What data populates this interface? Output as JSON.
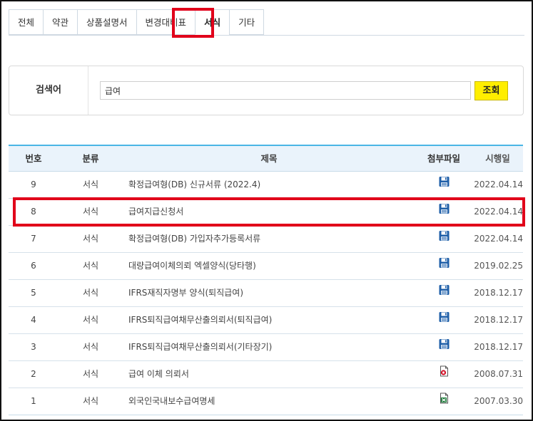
{
  "tabs": [
    {
      "label": "전체",
      "active": false
    },
    {
      "label": "약관",
      "active": false
    },
    {
      "label": "상품설명서",
      "active": false
    },
    {
      "label": "변경대비표",
      "active": false
    },
    {
      "label": "서식",
      "active": true
    },
    {
      "label": "기타",
      "active": false
    }
  ],
  "search": {
    "label": "검색어",
    "value": "급여",
    "button": "조회"
  },
  "table": {
    "headers": {
      "no": "번호",
      "category": "분류",
      "title": "제목",
      "attachment": "첨부파일",
      "date": "시행일"
    },
    "rows": [
      {
        "no": "9",
        "category": "서식",
        "title": "확정급여형(DB) 신규서류 (2022.4)",
        "icon": "save-icon",
        "date": "2022.04.14"
      },
      {
        "no": "8",
        "category": "서식",
        "title": "급여지급신청서",
        "icon": "save-icon",
        "date": "2022.04.14"
      },
      {
        "no": "7",
        "category": "서식",
        "title": "확정급여형(DB) 가입자추가등록서류",
        "icon": "save-icon",
        "date": "2022.04.14"
      },
      {
        "no": "6",
        "category": "서식",
        "title": "대량급여이체의뢰 엑셀양식(당타행)",
        "icon": "save-icon",
        "date": "2019.02.25"
      },
      {
        "no": "5",
        "category": "서식",
        "title": "IFRS재직자명부 양식(퇴직급여)",
        "icon": "save-icon",
        "date": "2018.12.17"
      },
      {
        "no": "4",
        "category": "서식",
        "title": "IFRS퇴직급여채무산출의뢰서(퇴직급여)",
        "icon": "save-icon",
        "date": "2018.12.17"
      },
      {
        "no": "3",
        "category": "서식",
        "title": "IFRS퇴직급여채무산출의뢰서(기타장기)",
        "icon": "save-icon",
        "date": "2018.12.17"
      },
      {
        "no": "2",
        "category": "서식",
        "title": "급여 이체 의뢰서",
        "icon": "document-file-icon",
        "date": "2008.07.31"
      },
      {
        "no": "1",
        "category": "서식",
        "title": "외국인국내보수급여명세",
        "icon": "excel-file-icon",
        "date": "2007.03.30"
      }
    ]
  },
  "colors": {
    "accent": "#4ab5e5",
    "highlight": "#e1001a",
    "button": "#ffee00",
    "header_bg": "#eaf3fb"
  }
}
